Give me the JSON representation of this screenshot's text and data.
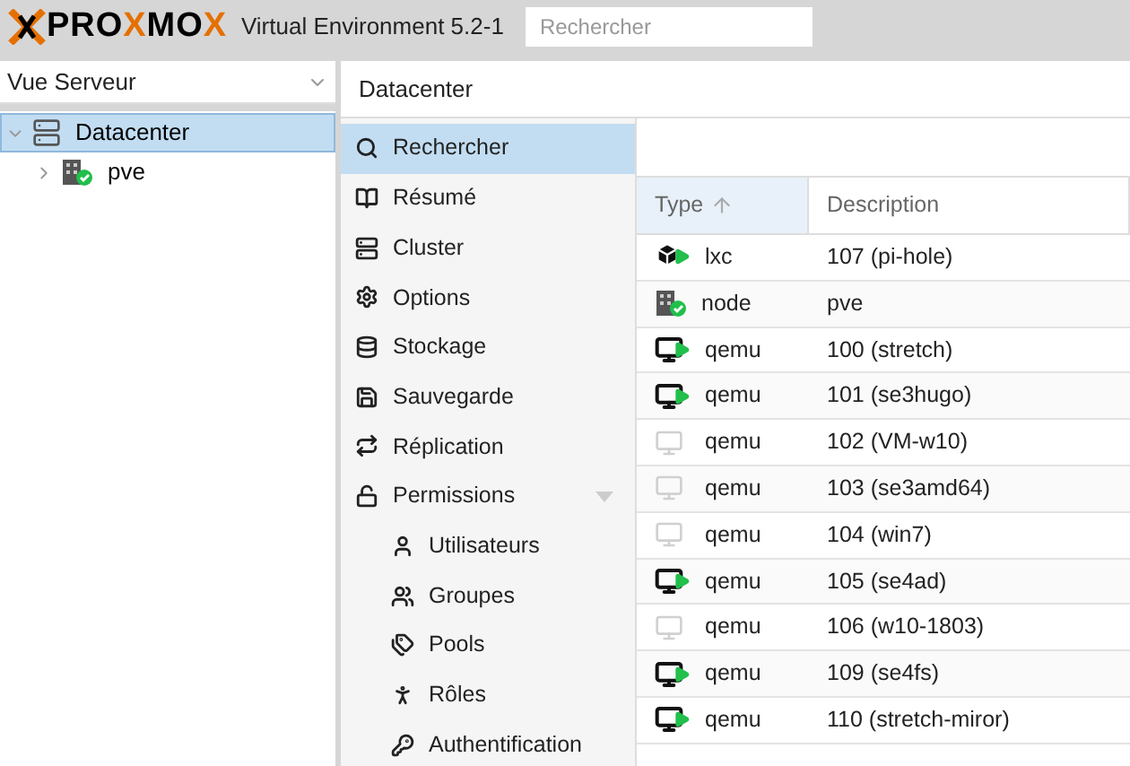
{
  "header": {
    "logo_parts": [
      {
        "text": "PRO",
        "color": "#000000"
      },
      {
        "text": "X",
        "color": "#e57000"
      },
      {
        "text": "MO",
        "color": "#000000"
      },
      {
        "text": "X",
        "color": "#e57000"
      }
    ],
    "title": "Virtual Environment 5.2-1",
    "search": {
      "placeholder": "Rechercher"
    }
  },
  "view_selector": {
    "value": "Vue Serveur"
  },
  "tree": [
    {
      "label": "Datacenter",
      "kind": "datacenter",
      "selected": true,
      "expanded": true,
      "children": [
        {
          "label": "pve",
          "kind": "node",
          "selected": false,
          "expanded": false
        }
      ]
    }
  ],
  "panel": {
    "title": "Datacenter"
  },
  "menu": [
    {
      "label": "Rechercher",
      "selected": true
    },
    {
      "label": "Résumé",
      "selected": false
    },
    {
      "label": "Cluster",
      "selected": false
    },
    {
      "label": "Options",
      "selected": false
    },
    {
      "label": "Stockage",
      "selected": false
    },
    {
      "label": "Sauvegarde",
      "selected": false
    },
    {
      "label": "Réplication",
      "selected": false
    },
    {
      "label": "Permissions",
      "selected": false,
      "expanded": true,
      "children": [
        {
          "label": "Utilisateurs",
          "selected": false
        },
        {
          "label": "Groupes",
          "selected": false
        },
        {
          "label": "Pools",
          "selected": false
        },
        {
          "label": "Rôles",
          "selected": false
        },
        {
          "label": "Authentification",
          "selected": false
        }
      ]
    }
  ],
  "table": {
    "columns": [
      {
        "label": "Type",
        "sorted": true
      },
      {
        "label": "Description",
        "sorted": false
      }
    ],
    "rows": [
      {
        "type": "lxc",
        "description": "107 (pi-hole)",
        "running": true
      },
      {
        "type": "node",
        "description": "pve",
        "running": true
      },
      {
        "type": "qemu",
        "description": "100 (stretch)",
        "running": true
      },
      {
        "type": "qemu",
        "description": "101 (se3hugo)",
        "running": true
      },
      {
        "type": "qemu",
        "description": "102 (VM-w10)",
        "running": false
      },
      {
        "type": "qemu",
        "description": "103 (se3amd64)",
        "running": false
      },
      {
        "type": "qemu",
        "description": "104 (win7)",
        "running": false
      },
      {
        "type": "qemu",
        "description": "105 (se4ad)",
        "running": true
      },
      {
        "type": "qemu",
        "description": "106 (w10-1803)",
        "running": false
      },
      {
        "type": "qemu",
        "description": "109 (se4fs)",
        "running": true
      },
      {
        "type": "qemu",
        "description": "110 (stretch-miror)",
        "running": true
      }
    ]
  }
}
